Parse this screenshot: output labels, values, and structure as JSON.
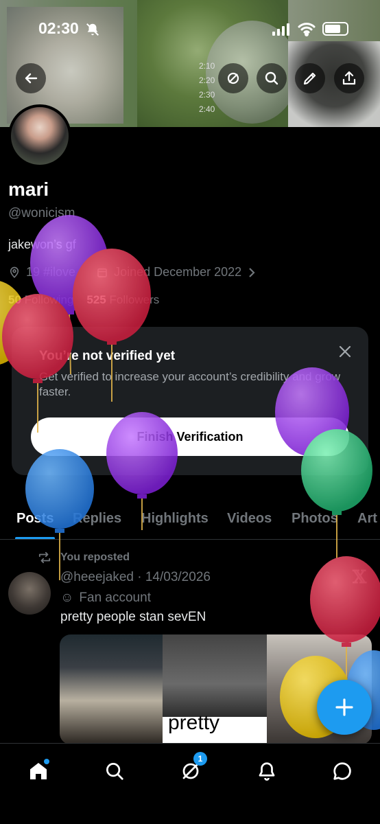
{
  "status": {
    "time": "02:30"
  },
  "banner": {
    "timeline": [
      "2:10",
      "2:20",
      "2:30",
      "2:40"
    ]
  },
  "profile": {
    "name": "mari",
    "handle": "@wonicism",
    "bio": "jakewon’s gf",
    "location": "19 #ilove",
    "joined": "Joined December 2022",
    "following_count": "50",
    "following_label": "Following",
    "followers_count": "525",
    "followers_label": "Followers"
  },
  "verify": {
    "title": "You’re not verified yet",
    "description": "Get verified to increase your account’s credibility and grow faster.",
    "button": "Finish Verification"
  },
  "tabs": [
    "Posts",
    "Replies",
    "Highlights",
    "Videos",
    "Photos",
    "Art"
  ],
  "post": {
    "reposted": "You reposted",
    "meta": "@heeejaked · 14/03/2026",
    "badge": "Fan account",
    "text": "pretty people stan sevEN",
    "media_text": "pretty"
  },
  "nav": {
    "messages_badge": "1"
  },
  "colors": {
    "accent": "#1d9bf0",
    "background": "#000000",
    "card": "#1c1f22",
    "muted": "#71767b"
  },
  "icons": [
    "back-icon",
    "no-filter-icon",
    "search-icon",
    "edit-icon",
    "share-icon",
    "location-icon",
    "calendar-icon",
    "close-icon",
    "repost-icon",
    "home-icon",
    "explore-icon",
    "grok-icon",
    "notifications-icon",
    "messages-icon",
    "plus-icon"
  ]
}
